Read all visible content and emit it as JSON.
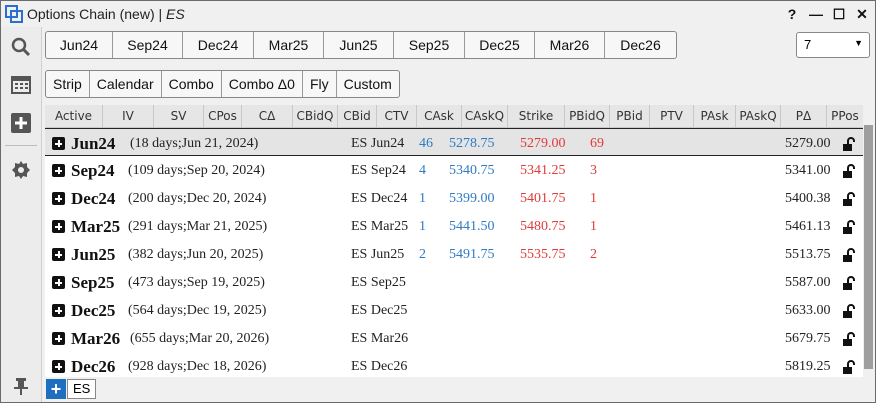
{
  "window": {
    "title": "Options Chain (new) | ",
    "instrument": "ES",
    "help_label": "?",
    "minimize_label": "—",
    "maximize_label": "☐",
    "close_label": "✕"
  },
  "sidebar": {
    "items": [
      "search-icon",
      "calendar-icon",
      "add-icon",
      "settings-icon",
      "pin-icon"
    ]
  },
  "expiry_tabs": [
    "Jun24",
    "Sep24",
    "Dec24",
    "Mar25",
    "Jun25",
    "Sep25",
    "Dec25",
    "Mar26",
    "Dec26"
  ],
  "count_dropdown": {
    "value": "7"
  },
  "strategy_buttons": [
    "Strip",
    "Calendar",
    "Combo",
    "Combo Δ0",
    "Fly",
    "Custom"
  ],
  "columns": [
    "Active",
    "IV",
    "SV",
    "CPos",
    "CΔ",
    "CBidQ",
    "CBid",
    "CTV",
    "CAsk",
    "CAskQ",
    "Strike",
    "PBidQ",
    "PBid",
    "PTV",
    "PAsk",
    "PAskQ",
    "PΔ",
    "PPos"
  ],
  "rows": [
    {
      "expiry": "Jun24",
      "detail": "(18 days;Jun 21, 2024)",
      "ctv": "ES Jun24",
      "cask": "46",
      "caskq": "5278.75",
      "strike": "5279.00",
      "pbidq": "69",
      "pdelta": "5279.00",
      "selected": true
    },
    {
      "expiry": "Sep24",
      "detail": "(109 days;Sep 20, 2024)",
      "ctv": "ES Sep24",
      "cask": "4",
      "caskq": "5340.75",
      "strike": "5341.25",
      "pbidq": "3",
      "pdelta": "5341.00",
      "selected": false
    },
    {
      "expiry": "Dec24",
      "detail": "(200 days;Dec 20, 2024)",
      "ctv": "ES Dec24",
      "cask": "1",
      "caskq": "5399.00",
      "strike": "5401.75",
      "pbidq": "1",
      "pdelta": "5400.38",
      "selected": false
    },
    {
      "expiry": "Mar25",
      "detail": "(291 days;Mar 21, 2025)",
      "ctv": "ES Mar25",
      "cask": "1",
      "caskq": "5441.50",
      "strike": "5480.75",
      "pbidq": "1",
      "pdelta": "5461.13",
      "selected": false
    },
    {
      "expiry": "Jun25",
      "detail": "(382 days;Jun 20, 2025)",
      "ctv": "ES Jun25",
      "cask": "2",
      "caskq": "5491.75",
      "strike": "5535.75",
      "pbidq": "2",
      "pdelta": "5513.75",
      "selected": false
    },
    {
      "expiry": "Sep25",
      "detail": "(473 days;Sep 19, 2025)",
      "ctv": "ES Sep25",
      "cask": "",
      "caskq": "",
      "strike": "",
      "pbidq": "",
      "pdelta": "5587.00",
      "selected": false
    },
    {
      "expiry": "Dec25",
      "detail": "(564 days;Dec 19, 2025)",
      "ctv": "ES Dec25",
      "cask": "",
      "caskq": "",
      "strike": "",
      "pbidq": "",
      "pdelta": "5633.00",
      "selected": false
    },
    {
      "expiry": "Mar26",
      "detail": "(655 days;Mar 20, 2026)",
      "ctv": "ES Mar26",
      "cask": "",
      "caskq": "",
      "strike": "",
      "pbidq": "",
      "pdelta": "5679.75",
      "selected": false
    },
    {
      "expiry": "Dec26",
      "detail": "(928 days;Dec 18, 2026)",
      "ctv": "ES Dec26",
      "cask": "",
      "caskq": "",
      "strike": "",
      "pbidq": "",
      "pdelta": "5819.25",
      "selected": false
    }
  ],
  "bottom": {
    "add_label": "+",
    "symbol_tab": "ES"
  },
  "colors": {
    "ask_blue": "#2e7bc4",
    "bid_red": "#e03a3a",
    "accent": "#1f6fc0"
  }
}
